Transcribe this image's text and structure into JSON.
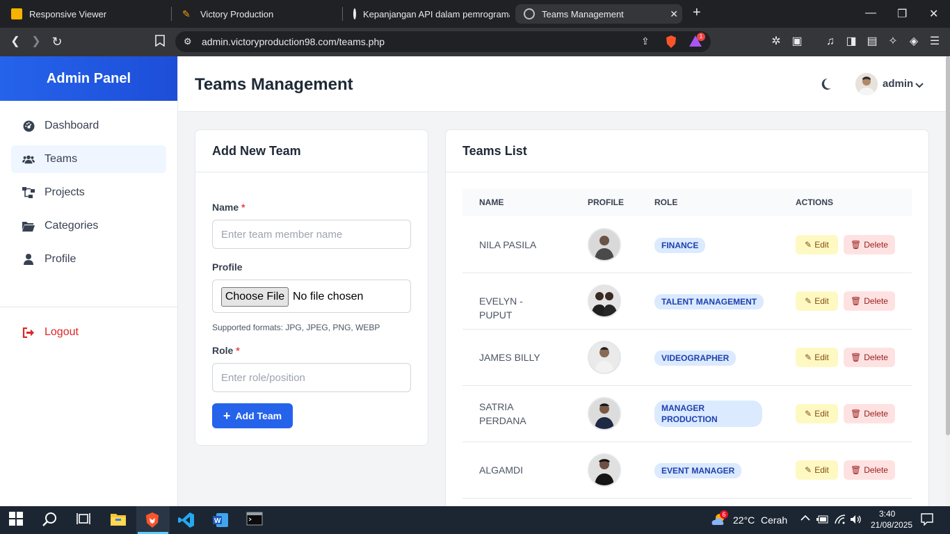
{
  "browser": {
    "tabs": [
      {
        "label": "Responsive Viewer",
        "icon": "responsive-viewer-icon"
      },
      {
        "label": "Victory Production",
        "icon": "victory-favicon"
      },
      {
        "label": "Kepanjangan API dalam pemrograma",
        "icon": "openai-icon"
      },
      {
        "label": "Teams Management",
        "icon": "globe-icon",
        "active": true
      }
    ],
    "url": "admin.victoryproduction98.com/teams.php",
    "notification_count": "1"
  },
  "sidebar": {
    "brand": "Admin Panel",
    "items": [
      {
        "label": "Dashboard",
        "icon": "dashboard-icon"
      },
      {
        "label": "Teams",
        "icon": "users-icon",
        "active": true
      },
      {
        "label": "Projects",
        "icon": "sitemap-icon"
      },
      {
        "label": "Categories",
        "icon": "folder-icon"
      },
      {
        "label": "Profile",
        "icon": "user-icon"
      }
    ],
    "logout": "Logout"
  },
  "header": {
    "title": "Teams Management",
    "username": "admin"
  },
  "form": {
    "title": "Add New Team",
    "name_label": "Name",
    "required_mark": "*",
    "name_placeholder": "Enter team member name",
    "profile_label": "Profile",
    "choose_file": "Choose File",
    "no_file": "No file chosen",
    "formats_hint": "Supported formats: JPG, JPEG, PNG, WEBP",
    "role_label": "Role",
    "role_placeholder": "Enter role/position",
    "submit": "Add Team"
  },
  "list": {
    "title": "Teams List",
    "columns": [
      "NAME",
      "PROFILE",
      "ROLE",
      "ACTIONS"
    ],
    "edit_label": "Edit",
    "delete_label": "Delete",
    "rows": [
      {
        "name": "NILA PASILA",
        "role": "FINANCE"
      },
      {
        "name": "EVELYN - PUPUT",
        "role": "TALENT MANAGEMENT"
      },
      {
        "name": "JAMES BILLY",
        "role": "VIDEOGRAPHER"
      },
      {
        "name": "SATRIA PERDANA",
        "role": "MANAGER PRODUCTION"
      },
      {
        "name": "ALGAMDI",
        "role": "EVENT MANAGER"
      }
    ]
  },
  "taskbar": {
    "weather_temp": "22°C",
    "weather_text": "Cerah",
    "weather_badge": "6",
    "time": "3:40",
    "date": "21/08/2025"
  },
  "colors": {
    "primary": "#2563eb",
    "danger": "#dc2626",
    "badge_bg": "#dbeafe",
    "edit_bg": "#fef9c3",
    "delete_bg": "#fee2e2"
  }
}
